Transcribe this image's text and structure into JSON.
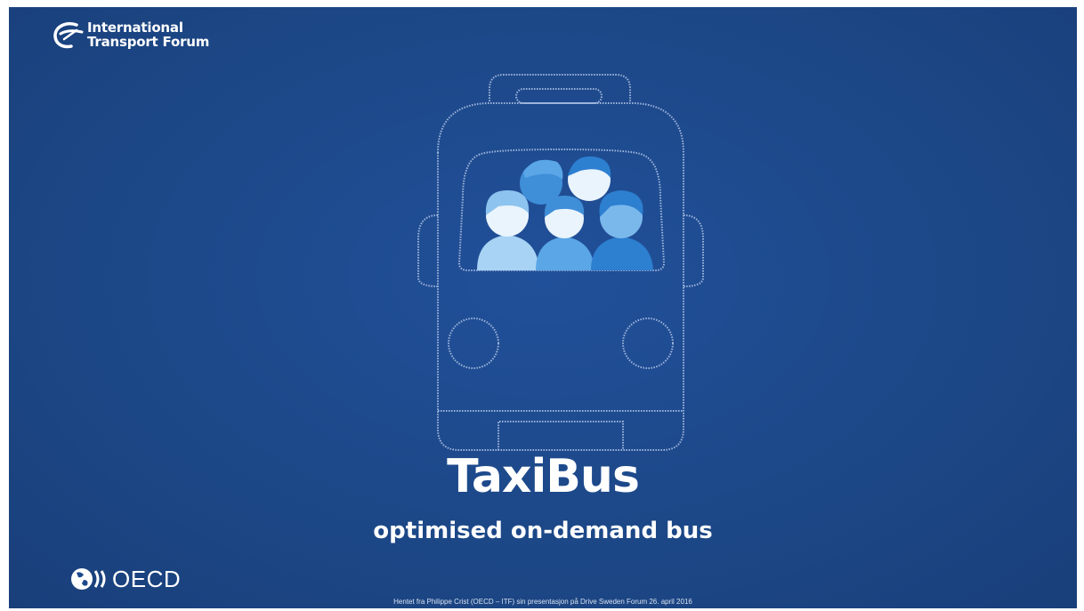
{
  "logo": {
    "line1": "International",
    "line2": "Transport Forum"
  },
  "illustration": {
    "icon": "bus-with-passengers-icon",
    "outline_color": "#9fb6dc",
    "passenger_colors": [
      "#5aa6e6",
      "#a9d3f4",
      "#2d7fd0"
    ]
  },
  "title": "TaxiBus",
  "subtitle": "optimised on-demand bus",
  "oecd": {
    "icon": "oecd-globe-icon",
    "label": "OECD"
  },
  "footer_note": "Hentet fra Philippe Crist (OECD – ITF) sin presentasjon på Drive Sweden Forum 26. april 2016",
  "colors": {
    "background": "#1d4a8c",
    "text": "#ffffff"
  }
}
